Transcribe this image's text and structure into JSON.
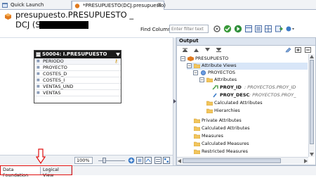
{
  "tabs": {
    "quick_launch": "Quick Launch",
    "editor": "*PRESUPUESTO(DCJ.presupuesto)",
    "close_glyph": "⊠"
  },
  "header": {
    "title_line1": "presupuesto.PRESUPUESTO _",
    "title_line2": "DCJ (S000",
    "find_label": "Find Column",
    "find_placeholder": "Enter filter text"
  },
  "entity": {
    "header": "S0004: I.PRESUPUESTO",
    "columns": [
      "PERIODO",
      "PROYECTO",
      "COSTES_D",
      "COSTES_I",
      "VENTAS_UND",
      "VENTAS"
    ]
  },
  "zoom": {
    "value": "100%"
  },
  "output": {
    "title": "Output",
    "tree": [
      {
        "label": "PRESUPUESTO",
        "level": 0,
        "toggle": "−",
        "icon": "cube-icon"
      },
      {
        "label": "Attribute Views",
        "level": 1,
        "toggle": "−",
        "icon": "folder-icon",
        "selected": true
      },
      {
        "label": "PROYECTOS",
        "level": 2,
        "toggle": "−",
        "icon": "view-icon"
      },
      {
        "label": "Attributes",
        "level": 3,
        "toggle": "−",
        "icon": "folder-icon"
      },
      {
        "label": "PROY_ID",
        "suffix": " : PROYECTOS.PROY_ID",
        "level": 4,
        "toggle": "",
        "icon": "key-icon",
        "bold": true
      },
      {
        "label": "PROY_DESC",
        "suffix": " : PROYECTOS.PROY_",
        "level": 4,
        "toggle": "",
        "icon": "attr-icon",
        "bold": true
      },
      {
        "label": "Calculated Attributes",
        "level": 3,
        "toggle": "",
        "icon": "folder-icon"
      },
      {
        "label": "Hierarchies",
        "level": 3,
        "toggle": "",
        "icon": "folder-icon"
      },
      {
        "label": "Private Attributes",
        "level": 1,
        "toggle": "",
        "icon": "folder-icon"
      },
      {
        "label": "Calculated Attributes",
        "level": 1,
        "toggle": "",
        "icon": "folder-icon"
      },
      {
        "label": "Measures",
        "level": 1,
        "toggle": "",
        "icon": "folder-icon"
      },
      {
        "label": "Calculated Measures",
        "level": 1,
        "toggle": "",
        "icon": "folder-icon"
      },
      {
        "label": "Restricted Measures",
        "level": 1,
        "toggle": "",
        "icon": "folder-icon"
      }
    ]
  },
  "bottom_tabs": {
    "data_foundation": "Data Foundation",
    "logical_view": "Logical View"
  },
  "colors": {
    "highlight": "#e01010",
    "selection": "#d8e6f8",
    "folder": "#f2c55c"
  }
}
